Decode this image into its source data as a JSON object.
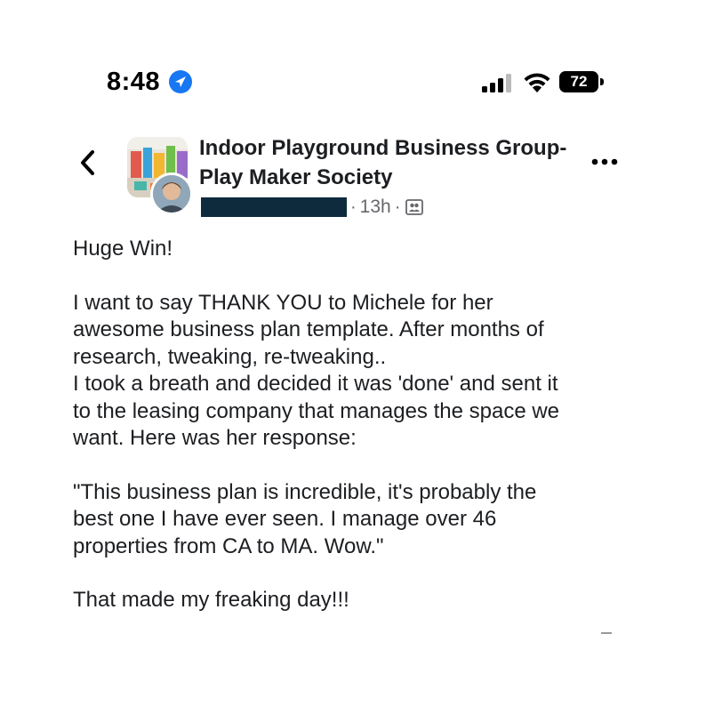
{
  "status_bar": {
    "time": "8:48",
    "battery": "72",
    "icons": [
      "location-arrow-icon",
      "cellular-signal-icon",
      "wifi-icon",
      "battery-icon"
    ],
    "location_color": "#1877f2"
  },
  "header": {
    "back_icon": "chevron-left-icon",
    "group_name": "Indoor Playground Business Group- Play Maker Society",
    "time_ago": "13h",
    "separator": "·",
    "audience_icon": "group-members-icon",
    "more_icon": "more-dots-icon"
  },
  "post": {
    "headline": "Huge Win!",
    "body": "I want to say THANK YOU to Michele for her\nawesome business plan template.  After months of\nresearch, tweaking, re-tweaking..\nI took a breath and decided it was 'done' and sent it\nto the leasing company that manages the space we\nwant. Here was her response:",
    "quote": "\"This business plan is incredible, it's probably the\nbest one I have ever seen. I manage over 46\nproperties from CA to MA. Wow.\"",
    "closing": "That made my freaking day!!!"
  },
  "colors": {
    "text": "#1c1e21",
    "secondary": "#65676b",
    "redaction": "#0e2a3d"
  }
}
